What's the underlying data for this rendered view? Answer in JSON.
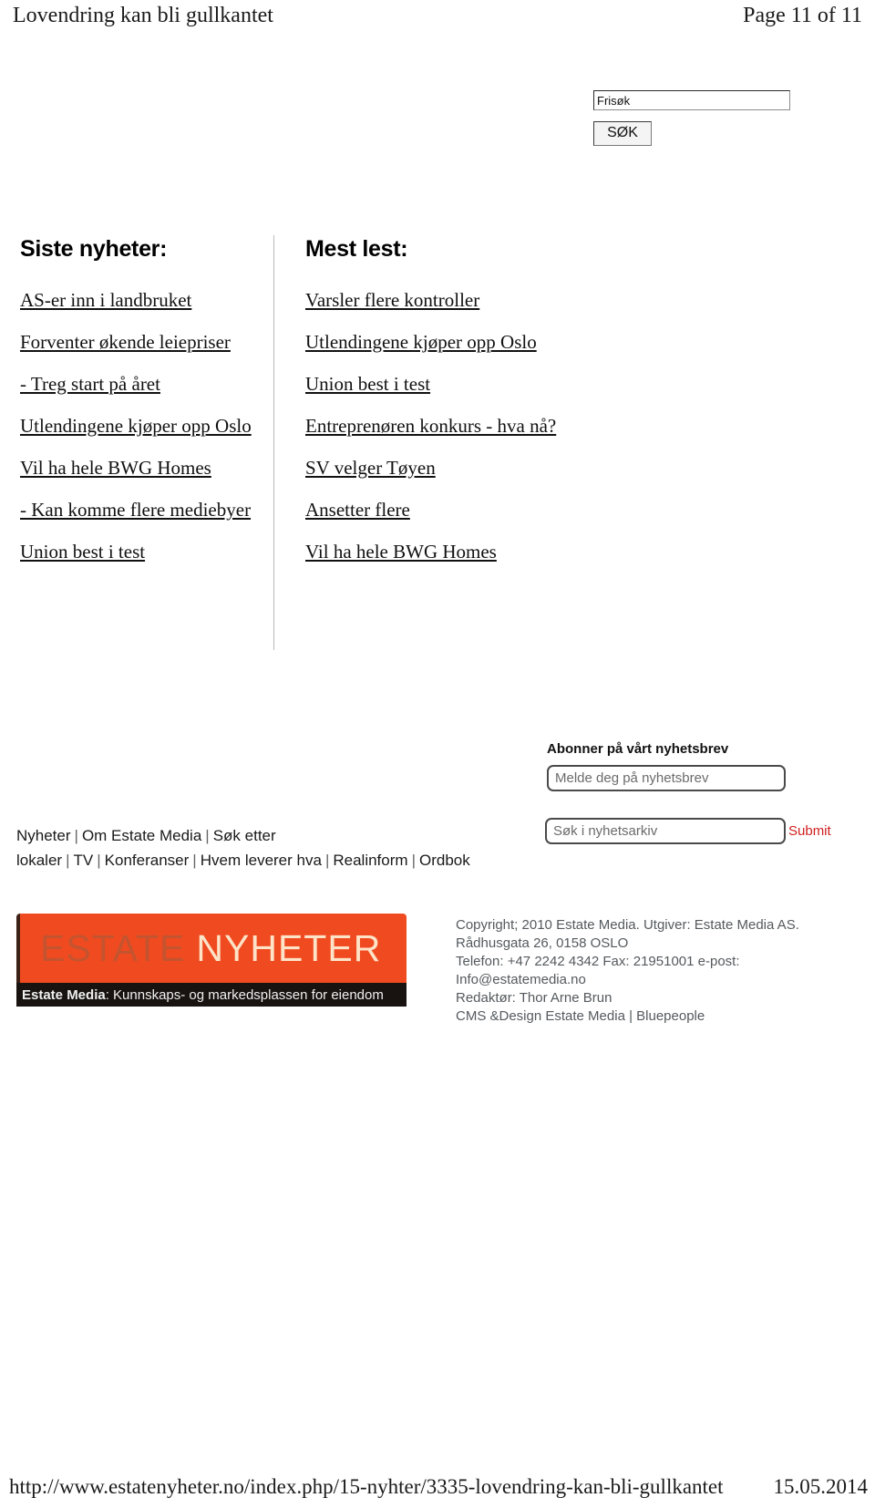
{
  "print_header": {
    "doc_title": "Lovendring kan bli gullkantet",
    "page_label": "Page 11 of 11"
  },
  "free_search": {
    "input_value": "Frisøk",
    "button_label": "SØK"
  },
  "latest_news": {
    "heading": "Siste nyheter:",
    "items": [
      "AS-er inn i landbruket",
      "Forventer økende leiepriser",
      "- Treg start på året",
      "Utlendingene kjøper opp Oslo",
      "Vil ha hele BWG Homes",
      "- Kan komme flere mediebyer",
      "Union best i test"
    ]
  },
  "most_read": {
    "heading": "Mest lest:",
    "items": [
      "Varsler flere kontroller",
      "Utlendingene kjøper opp Oslo",
      "Union best i test",
      "Entreprenøren konkurs - hva nå?",
      "SV velger Tøyen",
      "Ansetter flere",
      "Vil ha hele BWG Homes"
    ]
  },
  "newsletter": {
    "label": "Abonner på vårt nyhetsbrev",
    "placeholder": "Melde deg på nyhetsbrev",
    "value": ""
  },
  "archive_search": {
    "placeholder": "Søk i nyhetsarkiv",
    "value": "",
    "submit_label": "Submit",
    "submit_color": "#d1201f"
  },
  "footer_nav": {
    "items": [
      "Nyheter",
      "Om Estate Media",
      "Søk etter lokaler",
      "TV",
      "Konferanser",
      "Hvem leverer hva",
      "Realinform",
      "Ordbok"
    ],
    "separator": "|"
  },
  "logo": {
    "word_1": "ESTATE",
    "word_2": "NYHETER",
    "tagline_bold": "Estate Media",
    "tagline_rest": ": Kunnskaps- og markedsplassen for eiendom",
    "orange": "#f04b20",
    "dark": "#181310"
  },
  "copyright": {
    "line_1": "Copyright; 2010 Estate Media. Utgiver: Estate Media AS. Rådhusgata 26, 0158 OSLO",
    "line_2": "Telefon: +47 2242 4342 Fax: 21951001 e-post: Info@estatemedia.no",
    "line_3": "Redaktør: Thor Arne Brun",
    "line_4": "CMS &Design Estate Media | Bluepeople"
  },
  "print_footer": {
    "url": "http://www.estatenyheter.no/index.php/15-nyhter/3335-lovendring-kan-bli-gullkantet",
    "date": "15.05.2014"
  }
}
